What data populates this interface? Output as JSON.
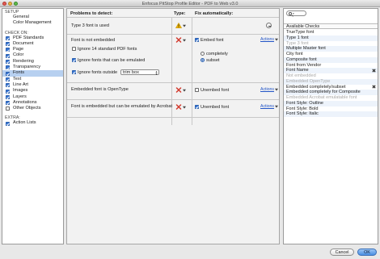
{
  "window": {
    "title": "Enfocus PitStop Profile Editor - PDF to Web v3.0"
  },
  "sidebar": {
    "setup_heading": "SETUP",
    "setup_items": [
      {
        "label": "General"
      },
      {
        "label": "Color Management"
      }
    ],
    "check_on_heading": "CHECK ON:",
    "check_items": [
      {
        "label": "PDF Standards",
        "checked": true
      },
      {
        "label": "Document",
        "checked": true
      },
      {
        "label": "Page",
        "checked": true
      },
      {
        "label": "Color",
        "checked": true
      },
      {
        "label": "Rendering",
        "checked": true
      },
      {
        "label": "Transparency",
        "checked": true
      },
      {
        "label": "Fonts",
        "checked": true,
        "selected": true
      },
      {
        "label": "Text",
        "checked": true
      },
      {
        "label": "Line Art",
        "checked": true
      },
      {
        "label": "Images",
        "checked": true
      },
      {
        "label": "Layers",
        "checked": true
      },
      {
        "label": "Annotations",
        "checked": true
      },
      {
        "label": "Other Objects",
        "checked": false
      }
    ],
    "extra_heading": "EXTRA:",
    "extra_items": [
      {
        "label": "Action Lists",
        "checked": true
      }
    ]
  },
  "main": {
    "col_problems": "Problems to detect:",
    "col_type": "Type:",
    "col_fix": "Fix automatically:",
    "rows": [
      {
        "problem": "Type 3 font is used",
        "type_icon": "warning-icon"
      },
      {
        "problem": "Font is not embedded",
        "type_icon": "error-x-icon",
        "options": [
          {
            "label": "Ignore 14 standard PDF fonts",
            "checked": false
          },
          {
            "label": "Ignore fonts that can be emulated",
            "checked": true
          },
          {
            "label": "Ignore fonts outside",
            "checked": true
          }
        ],
        "select_value": "trim box",
        "fix_label": "Embed font",
        "fix_checked": true,
        "radio_options": [
          {
            "label": "completely",
            "selected": false
          },
          {
            "label": "subset",
            "selected": true
          }
        ],
        "actions": "Actions"
      },
      {
        "problem": "Embedded font is OpenType",
        "type_icon": "error-x-icon",
        "fix_label": "Unembed font",
        "fix_checked": false,
        "actions": "Actions"
      },
      {
        "problem": "Font is embedded but can be emulated by Acrobat",
        "type_icon": "error-x-icon",
        "fix_label": "Unembed font",
        "fix_checked": true,
        "actions": "Actions"
      }
    ]
  },
  "available": {
    "search_placeholder": "",
    "heading": "Available Checks",
    "checks": [
      {
        "label": "TrueType font",
        "state": "normal"
      },
      {
        "label": "Type 1 font",
        "state": "normal"
      },
      {
        "label": "Type 3 font",
        "state": "dim"
      },
      {
        "label": "Multiple Master font",
        "state": "normal"
      },
      {
        "label": "City font",
        "state": "normal"
      },
      {
        "label": "Composite font",
        "state": "normal"
      },
      {
        "label": "Font from Vendor",
        "state": "normal"
      },
      {
        "label": "Font Name",
        "state": "normal",
        "remove": true
      },
      {
        "label": "Not embedded",
        "state": "dim"
      },
      {
        "label": "Embedded OpenType",
        "state": "dim"
      },
      {
        "label": "Embedded completely/subset",
        "state": "normal",
        "remove": true
      },
      {
        "label": "Embedded completely for Composite",
        "state": "normal"
      },
      {
        "label": "Embedded Acrobat emulatable font",
        "state": "dim"
      },
      {
        "label": "Font Style: Outline",
        "state": "normal"
      },
      {
        "label": "Font Style: Bold",
        "state": "normal"
      },
      {
        "label": "Font Style: Italic",
        "state": "normal"
      }
    ]
  },
  "footer": {
    "cancel_label": "Cancel",
    "ok_label": "OK"
  },
  "colors": {
    "accent": "#3a78d6",
    "selection": "#b7d0f0",
    "error_red": "#d23a2e",
    "warning_yellow": "#f0b400",
    "link_blue": "#2154c7"
  }
}
